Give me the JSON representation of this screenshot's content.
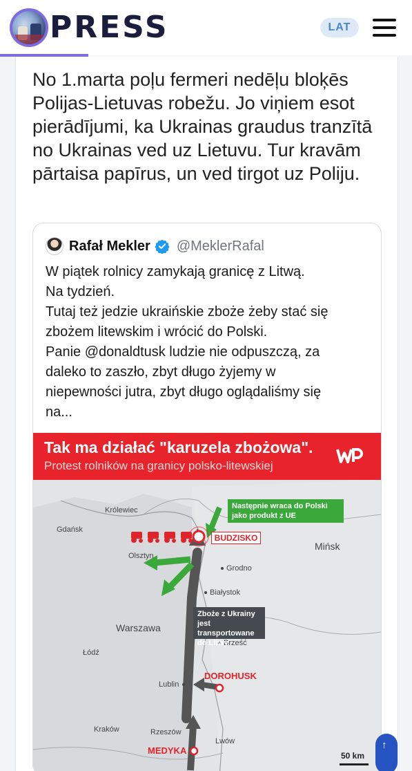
{
  "header": {
    "logo_text": "PRESS",
    "language": "LAT",
    "accent_color": "#7c6ce0"
  },
  "post": {
    "text": "No 1.marta poļu fermeri nedēļu bloķēs Polijas-Lietuvas robežu. Jo viņiem esot pierādījumi, ka Ukrainas graudus tranzītā no Ukrainas ved uz Lietuvu. Tur kravām pārtaisa papīrus, un ved tirgot uz Poliju."
  },
  "tweet": {
    "author_name": "Rafał Mekler",
    "handle": "@MeklerRafal",
    "verified": true,
    "body_lines": [
      "W piątek rolnicy zamykają granicę z Litwą.",
      "Na tydzień.",
      "Tutaj też jedzie ukraińskie zboże żeby stać się",
      "zbożem litewskim i wrócić do Polski.",
      "Panie @donaldtusk ludzie nie odpuszczą, za",
      "daleko to zaszło, zbyt długo żyjemy w",
      "niepewności jutra, zbyt długo oglądaliśmy się",
      "na..."
    ]
  },
  "infographic": {
    "title": "Tak ma działać \"karuzela zbożowa\".",
    "subtitle": "Protest rolników na granicy polsko-litewskiej",
    "brand_color": "#e8232b",
    "logo": "WP",
    "callout_return": "Następnie wraca do Polski jako produkt z UE",
    "callout_transport": "Zboże z Ukrainy jest transportowane do Litwy",
    "red_places": {
      "budzisko": "BUDZISKO",
      "dorohusk": "DOROHUSK",
      "medyka": "MEDYKA"
    },
    "cities": {
      "krolewiec": "Królewiec",
      "gdansk": "Gdańsk",
      "olsztyn": "Olsztyn",
      "grodno": "Grodno",
      "minsk": "Mińsk",
      "bialystok": "Białystok",
      "warszawa": "Warszawa",
      "brzesc": "Brześć",
      "lodz": "Łódź",
      "lublin": "Lublin",
      "krakow": "Kraków",
      "rzeszow": "Rzeszów",
      "lwow": "Lwów"
    },
    "scale": "50 km"
  },
  "scroll_top": {
    "icon": "arrow-up-icon"
  }
}
